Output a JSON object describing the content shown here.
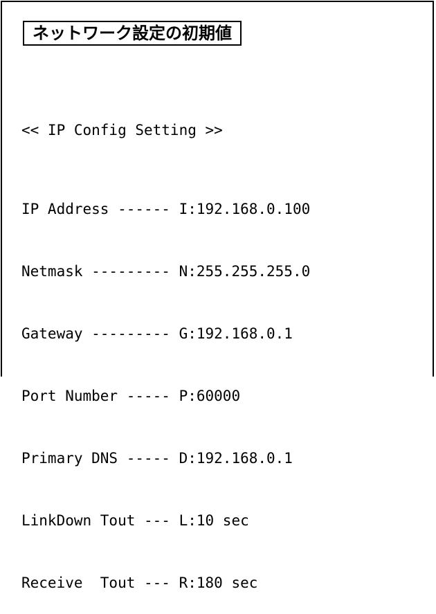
{
  "title": "ネットワーク設定の初期値",
  "header": "<< IP Config Setting >>",
  "settings": [
    {
      "label": "IP Address ------",
      "value": "I:192.168.0.100"
    },
    {
      "label": "Netmask ---------",
      "value": "N:255.255.255.0"
    },
    {
      "label": "Gateway ---------",
      "value": "G:192.168.0.1"
    },
    {
      "label": "Port Number -----",
      "value": "P:60000"
    },
    {
      "label": "Primary DNS -----",
      "value": "D:192.168.0.1"
    },
    {
      "label": "LinkDown Tout ---",
      "value": "L:10 sec"
    },
    {
      "label": "Receive  Tout ---",
      "value": "R:180 sec"
    }
  ]
}
